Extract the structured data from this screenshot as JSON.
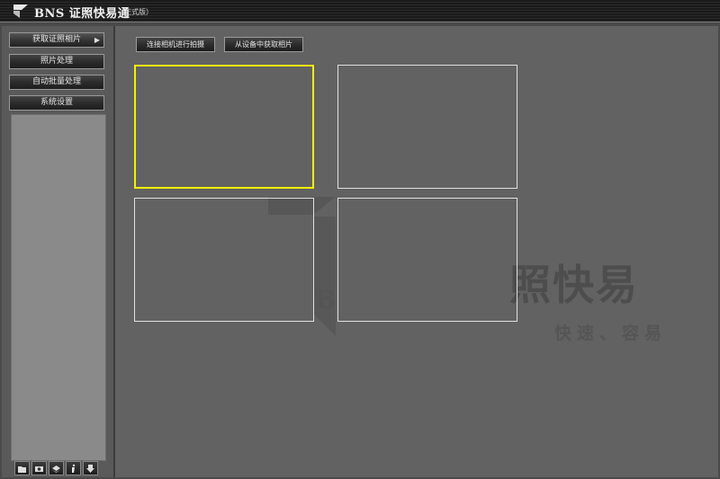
{
  "app": {
    "title": "BNS 证照快易通",
    "subtitle": "（正式版）",
    "logo_icon": "bns-logo-icon"
  },
  "sidebar": {
    "items": [
      {
        "label": "获取证照相片",
        "active": true
      },
      {
        "label": "照片处理"
      },
      {
        "label": "自动批量处理"
      },
      {
        "label": "系统设置"
      }
    ],
    "toolbar": [
      "open-icon",
      "camera-icon",
      "layers-icon",
      "info-icon",
      "export-icon"
    ]
  },
  "actions": {
    "connect_camera": "连接相机进行拍摄",
    "from_device": "从设备中获取相片"
  },
  "watermark": {
    "brand": "照快易",
    "slogan": "快速、容易",
    "letter": "B"
  },
  "photo_slots": [
    {
      "selected": true
    },
    {
      "selected": false
    },
    {
      "selected": false
    },
    {
      "selected": false
    }
  ]
}
